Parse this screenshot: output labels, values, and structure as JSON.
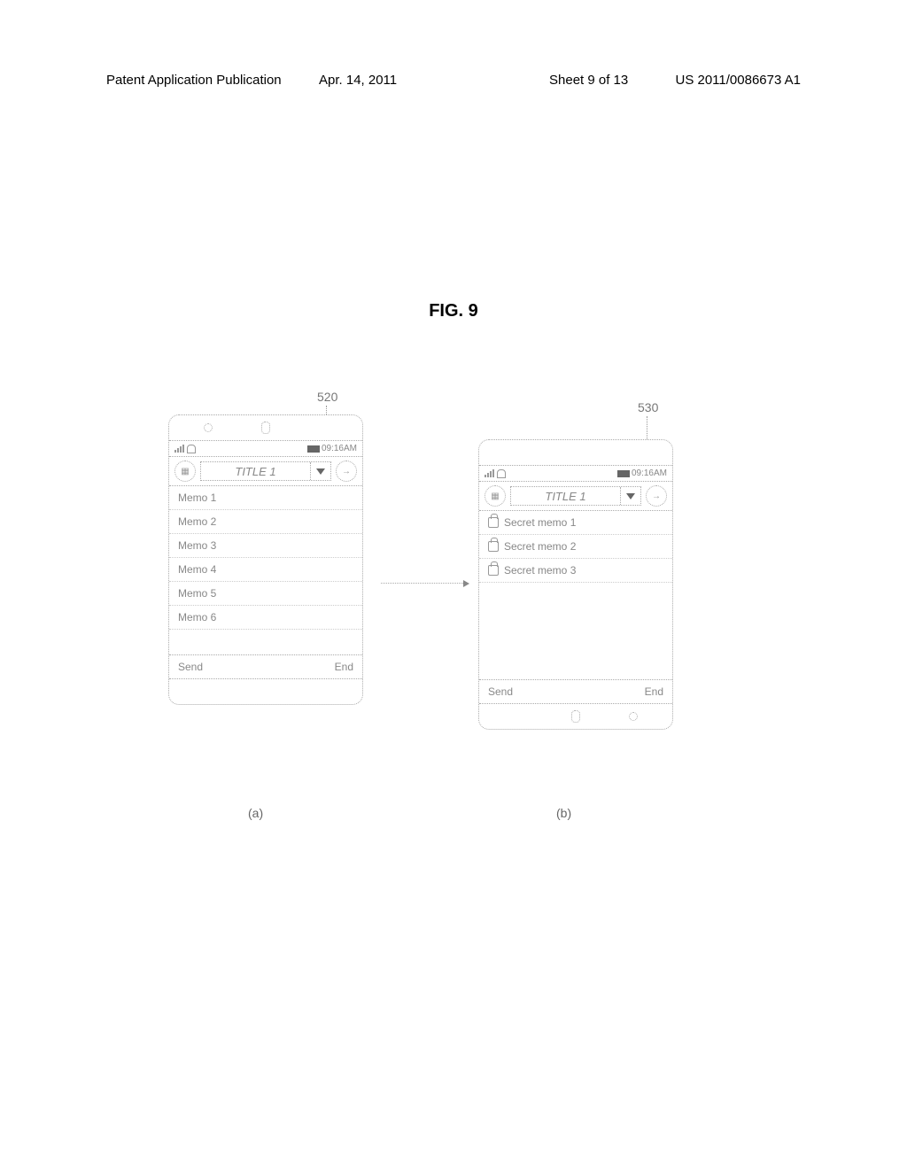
{
  "header": {
    "left": "Patent Application Publication",
    "date": "Apr. 14, 2011",
    "sheet": "Sheet 9 of 13",
    "pubno": "US 2011/0086673 A1"
  },
  "figure_title": "FIG. 9",
  "callouts": {
    "c520": "520",
    "c530": "530"
  },
  "phone_a": {
    "status": {
      "signal_text": "",
      "time": "09:16AM"
    },
    "title": "TITLE 1",
    "memos": [
      "Memo 1",
      "Memo 2",
      "Memo 3",
      "Memo 4",
      "Memo 5",
      "Memo 6"
    ],
    "send": "Send",
    "end": "End"
  },
  "phone_b": {
    "status": {
      "time": "09:16AM"
    },
    "title": "TITLE 1",
    "memos": [
      "Secret memo 1",
      "Secret memo 2",
      "Secret memo 3"
    ],
    "send": "Send",
    "end": "End"
  },
  "subfigures": {
    "a": "(a)",
    "b": "(b)"
  }
}
